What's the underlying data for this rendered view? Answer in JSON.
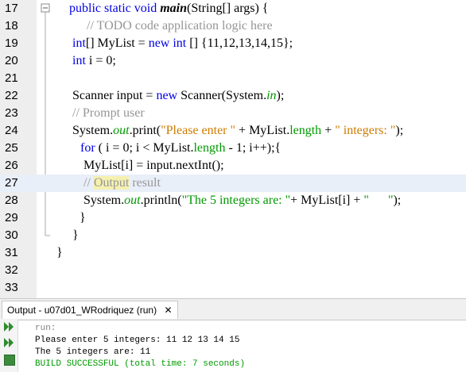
{
  "editor": {
    "lines": [
      {
        "n": "17",
        "parts": [
          {
            "t": "public static void ",
            "c": "kw"
          },
          {
            "t": "main",
            "c": "bold-it"
          },
          {
            "t": "(String[] args) {",
            "c": ""
          }
        ]
      },
      {
        "n": "18",
        "parts": [
          {
            "t": "// TODO code application logic here",
            "c": "cmt"
          }
        ]
      },
      {
        "n": "19",
        "parts": [
          {
            "t": "int",
            "c": "kw"
          },
          {
            "t": "[] MyList = ",
            "c": ""
          },
          {
            "t": "new int",
            "c": "kw"
          },
          {
            "t": " [] {11,12,13,14,15};",
            "c": ""
          }
        ]
      },
      {
        "n": "20",
        "parts": [
          {
            "t": "int",
            "c": "kw"
          },
          {
            "t": " i = 0;",
            "c": ""
          }
        ]
      },
      {
        "n": "21",
        "parts": []
      },
      {
        "n": "22",
        "parts": [
          {
            "t": "Scanner input = ",
            "c": ""
          },
          {
            "t": "new",
            "c": "kw"
          },
          {
            "t": " Scanner(System.",
            "c": ""
          },
          {
            "t": "in",
            "c": "static"
          },
          {
            "t": ");",
            "c": ""
          }
        ]
      },
      {
        "n": "23",
        "parts": [
          {
            "t": "// Prompt user",
            "c": "cmt"
          }
        ]
      },
      {
        "n": "24",
        "parts": [
          {
            "t": "System.",
            "c": ""
          },
          {
            "t": "out",
            "c": "static"
          },
          {
            "t": ".print(",
            "c": ""
          },
          {
            "t": "\"Please enter \"",
            "c": "str"
          },
          {
            "t": " + MyList.",
            "c": ""
          },
          {
            "t": "length",
            "c": "fld"
          },
          {
            "t": " + ",
            "c": ""
          },
          {
            "t": "\" integers: \"",
            "c": "str"
          },
          {
            "t": ");",
            "c": ""
          }
        ]
      },
      {
        "n": "25",
        "parts": [
          {
            "t": "for",
            "c": "kw"
          },
          {
            "t": " ( i = 0; i < MyList.",
            "c": ""
          },
          {
            "t": "length",
            "c": "fld"
          },
          {
            "t": " - 1; i++);{",
            "c": ""
          }
        ]
      },
      {
        "n": "26",
        "parts": [
          {
            "t": "MyList[i] = input.nextInt();",
            "c": ""
          }
        ]
      },
      {
        "n": "27",
        "parts": [
          {
            "t": "// ",
            "c": "cmt"
          },
          {
            "t": "Output",
            "c": "cmt mark"
          },
          {
            "t": " result",
            "c": "cmt"
          }
        ]
      },
      {
        "n": "28",
        "parts": [
          {
            "t": "System.",
            "c": ""
          },
          {
            "t": "out",
            "c": "static"
          },
          {
            "t": ".println(",
            "c": ""
          },
          {
            "t": "\"The 5 integers are: \"",
            "c": "str2"
          },
          {
            "t": "+ MyList[i] + ",
            "c": ""
          },
          {
            "t": "\"      \"",
            "c": "str2"
          },
          {
            "t": ");",
            "c": ""
          }
        ]
      },
      {
        "n": "29",
        "parts": [
          {
            "t": "}",
            "c": ""
          }
        ]
      },
      {
        "n": "30",
        "parts": [
          {
            "t": "}",
            "c": ""
          }
        ]
      },
      {
        "n": "31",
        "parts": [
          {
            "t": "}",
            "c": ""
          }
        ]
      },
      {
        "n": "32",
        "parts": []
      },
      {
        "n": "33",
        "parts": []
      }
    ]
  },
  "output": {
    "tab_label": "Output - u07d01_WRodriquez (run)",
    "close_glyph": "✕",
    "lines": [
      {
        "t": "run:",
        "color": "#808080"
      },
      {
        "t": "Please enter 5 integers: 11 12 13 14 15",
        "color": "#000000"
      },
      {
        "t": "The 5 integers are: 11",
        "color": "#000000"
      },
      {
        "t": "BUILD SUCCESSFUL (total time: 7 seconds)",
        "color": "#009900"
      }
    ],
    "run_icon_color": "#2e8b2e"
  }
}
